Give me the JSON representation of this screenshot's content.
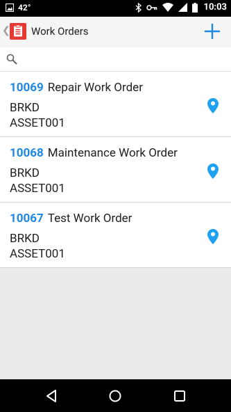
{
  "status_bar": {
    "temperature": "42°",
    "time": "10:03"
  },
  "action_bar": {
    "title": "Work Orders"
  },
  "search": {
    "placeholder": "",
    "value": ""
  },
  "work_orders": [
    {
      "id": "10069",
      "title": "Repair Work Order",
      "type": "BRKD",
      "asset": "ASSET001"
    },
    {
      "id": "10068",
      "title": "Maintenance Work Order",
      "type": "BRKD",
      "asset": "ASSET001"
    },
    {
      "id": "10067",
      "title": "Test Work Order",
      "type": "BRKD",
      "asset": "ASSET001"
    }
  ],
  "colors": {
    "accent": "#1e88e5",
    "app_icon": "#e53935",
    "pin": "#1ea1f2"
  }
}
